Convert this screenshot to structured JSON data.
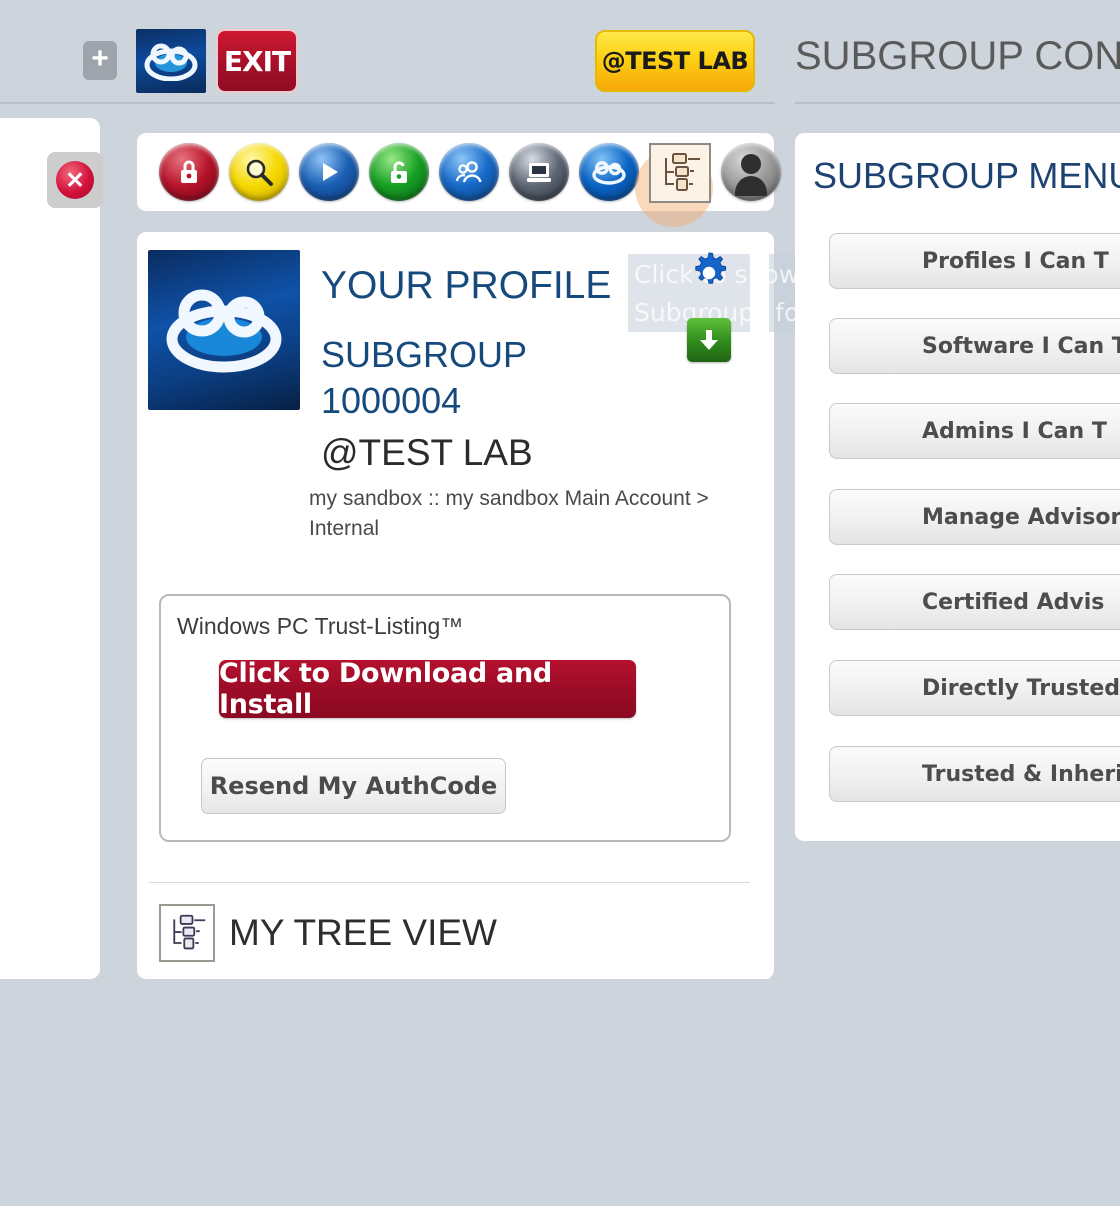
{
  "topbar": {
    "add_label": "+",
    "exit_label": "EXIT",
    "lab_badge": "@TEST LAB",
    "page_title": "SUBGROUP CONFIGU",
    "logo_name": "cloud-logo"
  },
  "left_rail": {
    "close_label": "✕"
  },
  "toolbar": {
    "icons": [
      {
        "name": "red-lock-icon",
        "label": "Security Lock"
      },
      {
        "name": "yellow-search-icon",
        "label": "Search"
      },
      {
        "name": "blue-play-icon",
        "label": "Play"
      },
      {
        "name": "green-unlock-icon",
        "label": "Unlock"
      },
      {
        "name": "blue-users-icon",
        "label": "Users"
      },
      {
        "name": "gray-device-icon",
        "label": "Device"
      },
      {
        "name": "blue-cloud-icon",
        "label": "Cloud"
      },
      {
        "name": "tree-view-icon",
        "label": "Tree View"
      },
      {
        "name": "user-avatar-icon",
        "label": "My Account"
      }
    ]
  },
  "profile": {
    "heading": "YOUR PROFILE",
    "subgroup_line": "SUBGROUP 1000004",
    "lab_name": "@TEST LAB",
    "path": "my sandbox :: my sandbox Main Account > Internal",
    "trust_box": {
      "title": "Windows PC Trust-Listing™",
      "download_label": "Click to Download and Install",
      "resend_label": "Resend My AuthCode"
    },
    "tree_view_label": "MY TREE VIEW"
  },
  "overlay": {
    "tooltip_text": "Click to show Tree View of Subgroups for this Subgroup",
    "gear_name": "settings-gear-icon",
    "download_name": "download-arrow-icon"
  },
  "right_panel": {
    "title": "SUBGROUP MENU",
    "buttons": [
      {
        "label": "Profiles I Can T"
      },
      {
        "label": "Software I Can T"
      },
      {
        "label": "Admins I Can T"
      },
      {
        "label": "Manage Advisor A"
      },
      {
        "label": "Certified Advis"
      },
      {
        "label": "Directly Trusted P"
      },
      {
        "label": "Trusted & Inherited"
      }
    ]
  },
  "colors": {
    "background": "#ced4dc",
    "panel": "#ffffff",
    "title_blue": "#1d4372",
    "accent_red": "#9c0c27",
    "badge_yellow": "#fdd112"
  }
}
